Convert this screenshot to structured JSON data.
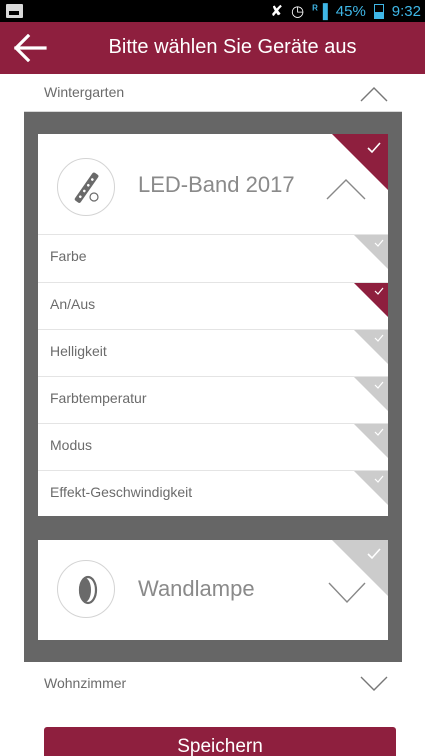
{
  "status_bar": {
    "battery_percent": "45%",
    "battery_level": 0.45,
    "time": "9:32",
    "signal_badge": "R",
    "icons": [
      "image-icon",
      "mute-icon",
      "alarm-icon",
      "signal-icon",
      "battery-icon"
    ]
  },
  "header": {
    "title": "Bitte wählen Sie Geräte aus",
    "back_icon": "arrow-left-icon"
  },
  "rooms": {
    "top": {
      "label": "Wintergarten",
      "expanded": true
    },
    "bottom": {
      "label": "Wohnzimmer",
      "expanded": false
    }
  },
  "devices": [
    {
      "name": "LED-Band 2017",
      "icon": "led-strip-icon",
      "selected": true,
      "expanded": true,
      "functions": [
        {
          "label": "Farbe",
          "selected": false
        },
        {
          "label": "An/Aus",
          "selected": true
        },
        {
          "label": "Helligkeit",
          "selected": false
        },
        {
          "label": "Farbtemperatur",
          "selected": false
        },
        {
          "label": "Modus",
          "selected": false
        },
        {
          "label": "Effekt-Geschwindigkeit",
          "selected": false
        }
      ]
    },
    {
      "name": "Wandlampe",
      "icon": "wall-lamp-icon",
      "selected": false,
      "expanded": false
    }
  ],
  "actions": {
    "save_label": "Speichern"
  },
  "colors": {
    "brand": "#8e1f3e",
    "panel": "#666666",
    "unchecked_corner": "#cccccc",
    "status_accent": "#3fb7e7"
  }
}
